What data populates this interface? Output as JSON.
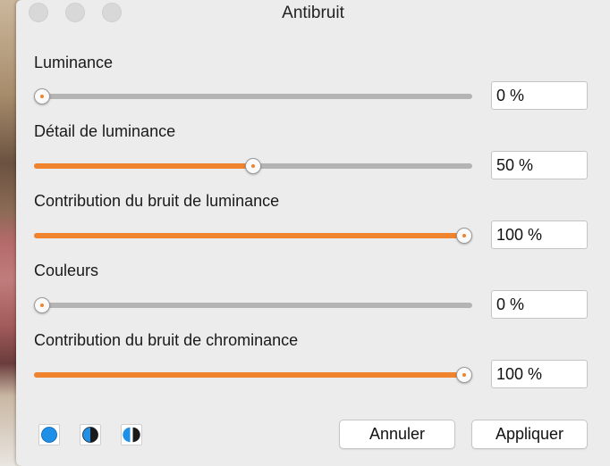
{
  "window": {
    "title": "Antibruit"
  },
  "sliders": [
    {
      "label": "Luminance",
      "value_text": "0 %",
      "fraction": 0.0
    },
    {
      "label": "Détail de luminance",
      "value_text": "50 %",
      "fraction": 0.5
    },
    {
      "label": "Contribution du bruit de luminance",
      "value_text": "100 %",
      "fraction": 1.0
    },
    {
      "label": "Couleurs",
      "value_text": "0 %",
      "fraction": 0.0
    },
    {
      "label": "Contribution du bruit de chrominance",
      "value_text": "100 %",
      "fraction": 1.0
    }
  ],
  "buttons": {
    "cancel": "Annuler",
    "apply": "Appliquer"
  },
  "mode_icons": [
    "full-circle-icon",
    "half-circle-icon",
    "split-circle-icon"
  ],
  "colors": {
    "accent": "#f0832d",
    "icon_blue": "#1e90e8"
  }
}
